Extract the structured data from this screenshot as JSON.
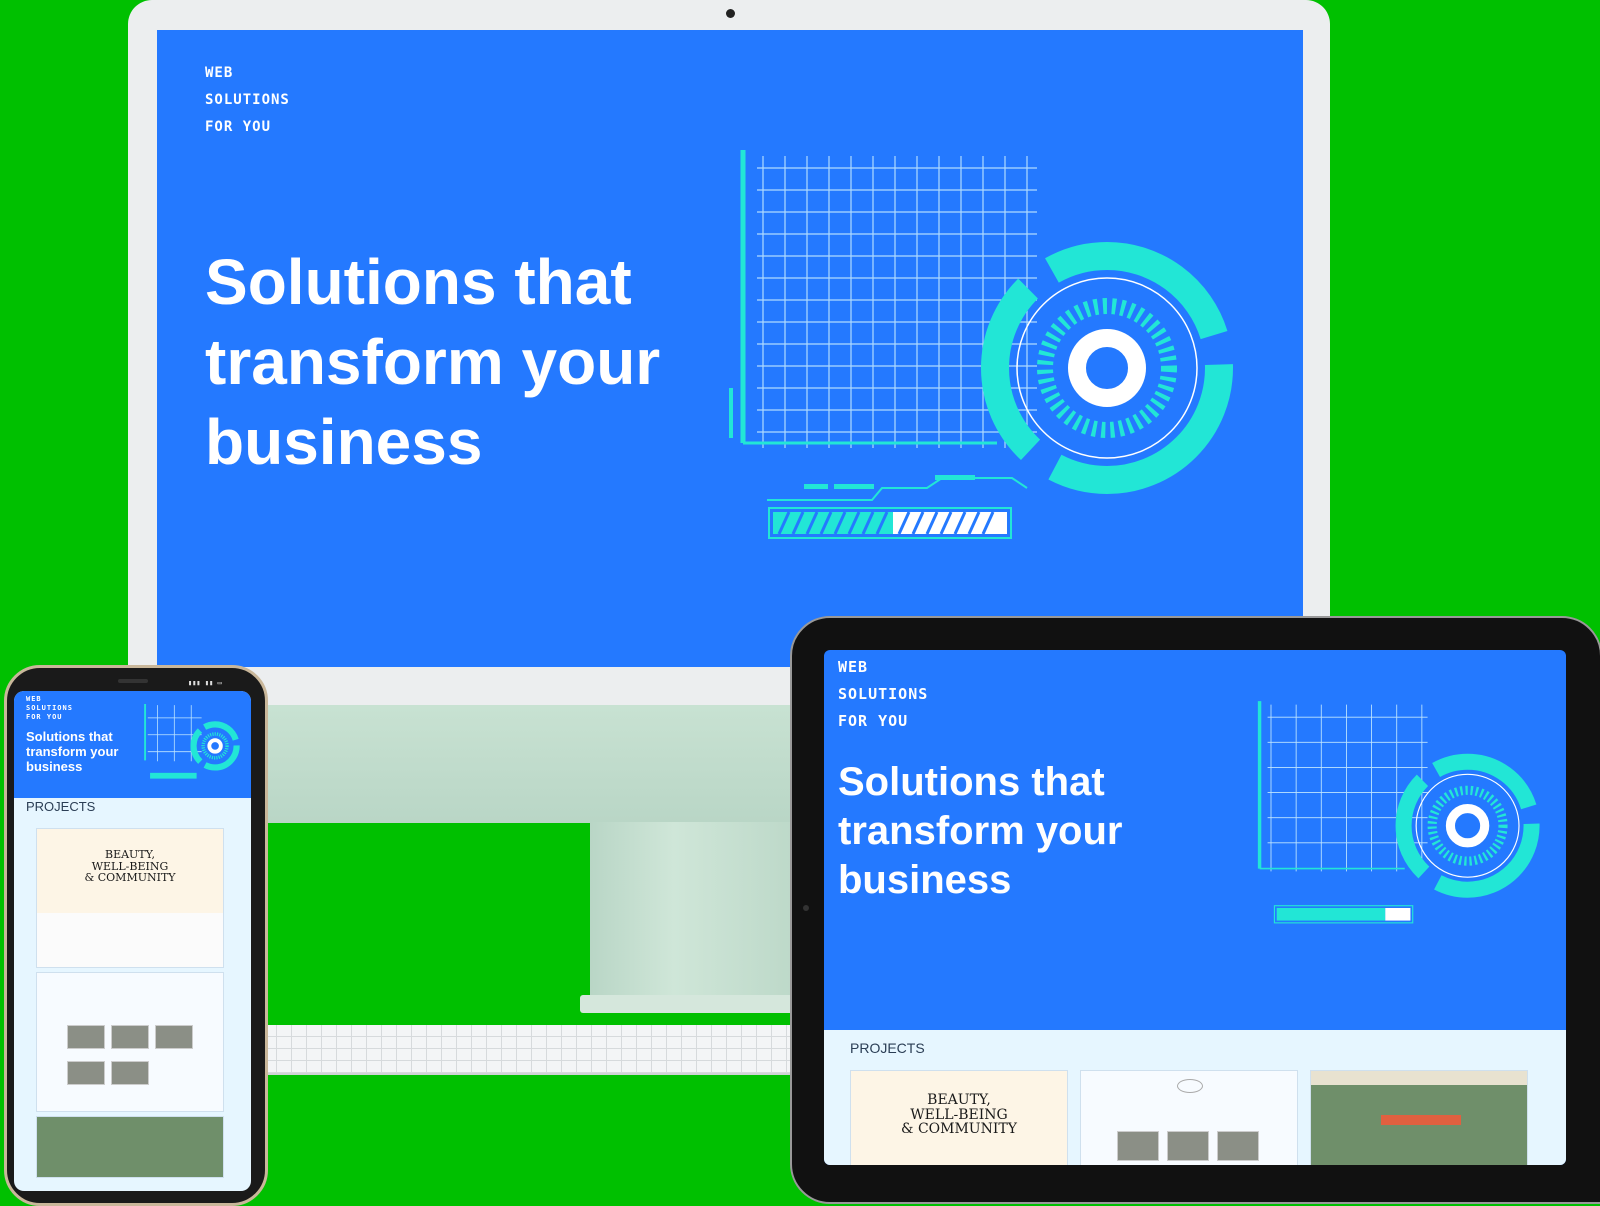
{
  "brand": {
    "line1": "WEB",
    "line2": "SOLUTIONS",
    "line3": "FOR YOU"
  },
  "hero": {
    "line1": "Solutions that",
    "line2": "transform your",
    "line3": "business"
  },
  "projects": {
    "heading": "PROJECTS",
    "card1": {
      "line1": "BEAUTY,",
      "line2": "WELL-BEING",
      "line3": "& COMMUNITY"
    }
  },
  "colors": {
    "background": "#00c000",
    "hero_blue": "#2479ff",
    "accent_cyan": "#22e6d6",
    "projects_bg": "#e6f6ff"
  }
}
